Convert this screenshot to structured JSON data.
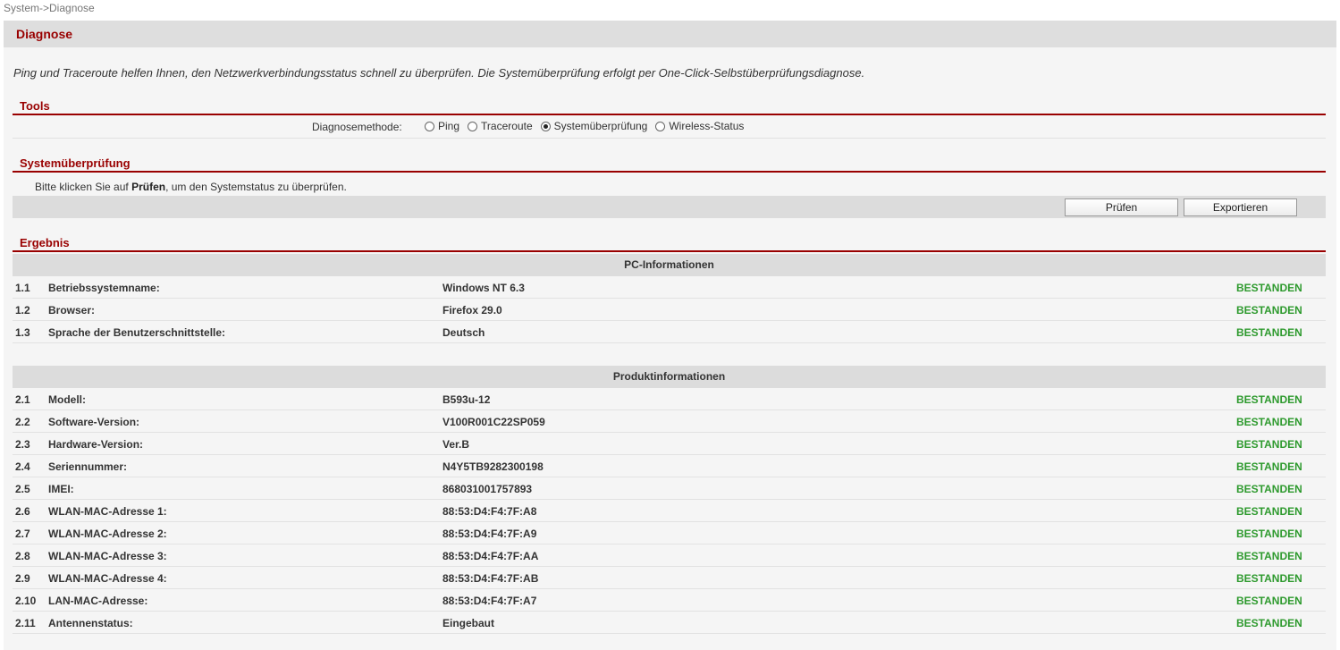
{
  "breadcrumb": "System->Diagnose",
  "page": {
    "title": "Diagnose",
    "intro": "Ping und Traceroute helfen Ihnen, den Netzwerkverbindungsstatus schnell zu überprüfen. Die Systemüberprüfung erfolgt per One-Click-Selbstüberprüfungsdiagnose."
  },
  "tools": {
    "title": "Tools",
    "method_label": "Diagnosemethode:",
    "options": [
      "Ping",
      "Traceroute",
      "Systemüberprüfung",
      "Wireless-Status"
    ],
    "selected": "Systemüberprüfung"
  },
  "check": {
    "title": "Systemüberprüfung",
    "instruction_prefix": "Bitte klicken Sie auf ",
    "instruction_bold": "Prüfen",
    "instruction_suffix": ", um den Systemstatus zu überprüfen.",
    "check_button": "Prüfen",
    "export_button": "Exportieren"
  },
  "result": {
    "title": "Ergebnis",
    "pc": {
      "heading": "PC-Informationen",
      "rows": [
        {
          "num": "1.1",
          "label": "Betriebssystemname:",
          "value": "Windows NT 6.3",
          "status": "BESTANDEN"
        },
        {
          "num": "1.2",
          "label": "Browser:",
          "value": "Firefox 29.0",
          "status": "BESTANDEN"
        },
        {
          "num": "1.3",
          "label": "Sprache der Benutzerschnittstelle:",
          "value": "Deutsch",
          "status": "BESTANDEN"
        }
      ]
    },
    "product": {
      "heading": "Produktinformationen",
      "rows": [
        {
          "num": "2.1",
          "label": "Modell:",
          "value": "B593u-12",
          "status": "BESTANDEN"
        },
        {
          "num": "2.2",
          "label": "Software-Version:",
          "value": "V100R001C22SP059",
          "status": "BESTANDEN"
        },
        {
          "num": "2.3",
          "label": "Hardware-Version:",
          "value": "Ver.B",
          "status": "BESTANDEN"
        },
        {
          "num": "2.4",
          "label": "Seriennummer:",
          "value": "N4Y5TB9282300198",
          "status": "BESTANDEN"
        },
        {
          "num": "2.5",
          "label": "IMEI:",
          "value": "868031001757893",
          "status": "BESTANDEN"
        },
        {
          "num": "2.6",
          "label": "WLAN-MAC-Adresse 1:",
          "value": "88:53:D4:F4:7F:A8",
          "status": "BESTANDEN"
        },
        {
          "num": "2.7",
          "label": "WLAN-MAC-Adresse 2:",
          "value": "88:53:D4:F4:7F:A9",
          "status": "BESTANDEN"
        },
        {
          "num": "2.8",
          "label": "WLAN-MAC-Adresse 3:",
          "value": "88:53:D4:F4:7F:AA",
          "status": "BESTANDEN"
        },
        {
          "num": "2.9",
          "label": "WLAN-MAC-Adresse 4:",
          "value": "88:53:D4:F4:7F:AB",
          "status": "BESTANDEN"
        },
        {
          "num": "2.10",
          "label": "LAN-MAC-Adresse:",
          "value": "88:53:D4:F4:7F:A7",
          "status": "BESTANDEN"
        },
        {
          "num": "2.11",
          "label": "Antennenstatus:",
          "value": "Eingebaut",
          "status": "BESTANDEN"
        }
      ]
    }
  },
  "colors": {
    "accent": "#990000",
    "pass": "#2e9a2e",
    "header_bg": "#dedede"
  }
}
